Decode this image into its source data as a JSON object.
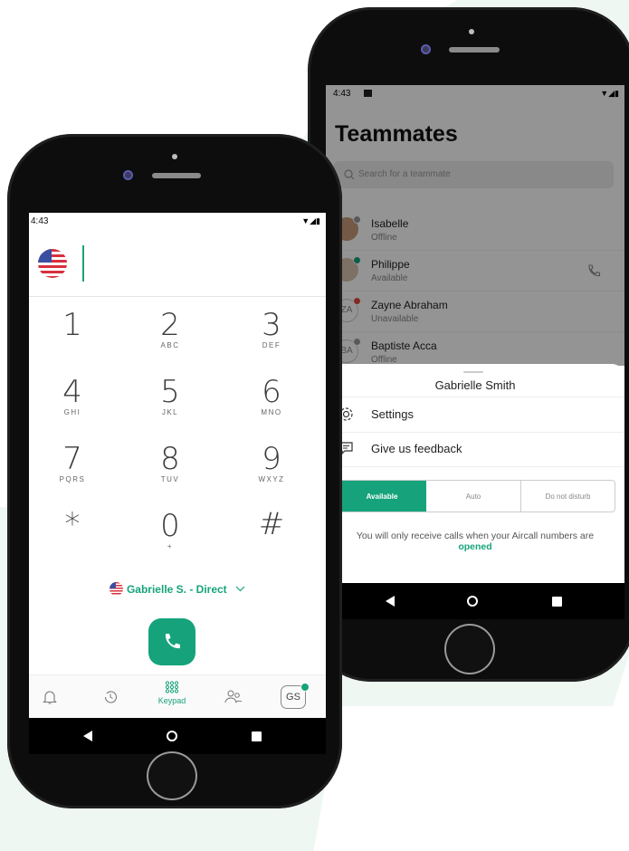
{
  "colors": {
    "accent": "#16a37b",
    "accent_light": "#eef7f2",
    "dark": "#0d0d0d"
  },
  "left_phone": {
    "status_time": "4:43",
    "keys": [
      {
        "digit": "1",
        "letters": ""
      },
      {
        "digit": "2",
        "letters": "ABC"
      },
      {
        "digit": "3",
        "letters": "DEF"
      },
      {
        "digit": "4",
        "letters": "GHI"
      },
      {
        "digit": "5",
        "letters": "JKL"
      },
      {
        "digit": "6",
        "letters": "MNO"
      },
      {
        "digit": "7",
        "letters": "PQRS"
      },
      {
        "digit": "8",
        "letters": "TUV"
      },
      {
        "digit": "9",
        "letters": "WXYZ"
      },
      {
        "digit": "*",
        "letters": ""
      },
      {
        "digit": "0",
        "letters": "+"
      },
      {
        "digit": "#",
        "letters": ""
      }
    ],
    "line_selector": "Gabrielle S. - Direct",
    "tabs": {
      "keypad_label": "Keypad",
      "avatar_initials": "GS"
    }
  },
  "right_phone": {
    "status_time": "4:43",
    "title": "Teammates",
    "search_placeholder": "Search for a teammate",
    "teammates": [
      {
        "name": "Isabelle",
        "status": "Offline"
      },
      {
        "name": "Philippe",
        "status": "Available"
      },
      {
        "name": "Zayne Abraham",
        "status": "Unavailable",
        "initials": "ZA"
      },
      {
        "name": "Baptiste Acca",
        "status": "Offline",
        "initials": "BA"
      }
    ],
    "sheet": {
      "user_name": "Gabrielle Smith",
      "settings_label": "Settings",
      "feedback_label": "Give us feedback",
      "status_options": [
        "Available",
        "Auto",
        "Do not disturb"
      ],
      "note_text": "You will only receive calls when your Aircall numbers are",
      "note_highlight": "opened"
    }
  }
}
